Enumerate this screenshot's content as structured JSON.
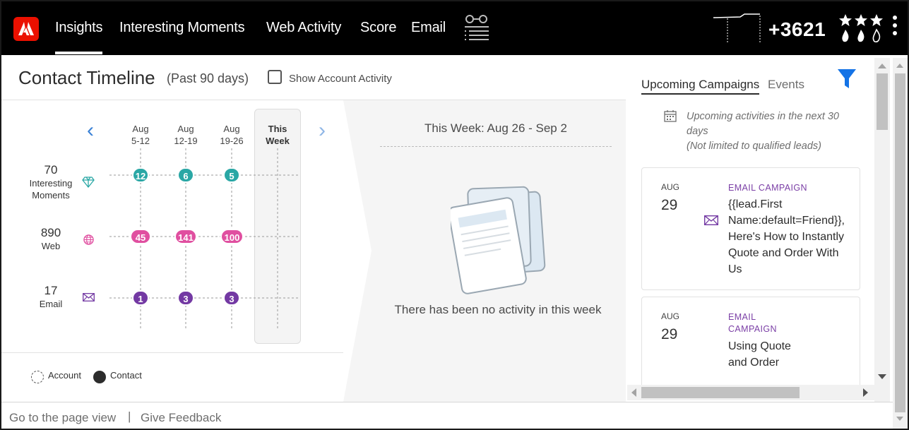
{
  "nav": {
    "tabs": [
      {
        "label": "Insights",
        "active": true
      },
      {
        "label": "Interesting Moments",
        "active": false
      },
      {
        "label": "Web Activity",
        "active": false
      },
      {
        "label": "Score",
        "active": false
      },
      {
        "label": "Email",
        "active": false
      }
    ],
    "score": "+3621",
    "icons": [
      "adobe-logo-icon",
      "glasses-list-icon",
      "score-sparkline-icon",
      "stars-flames-icon",
      "more-vertical-icon"
    ]
  },
  "timeline": {
    "title": "Contact Timeline",
    "range": "(Past 90 days)",
    "show_account_label": "Show Account Activity",
    "show_account_checked": false,
    "columns": [
      {
        "month": "Aug",
        "days": "5-12"
      },
      {
        "month": "Aug",
        "days": "12-19"
      },
      {
        "month": "Aug",
        "days": "19-26"
      },
      {
        "month": "This",
        "days": "Week"
      }
    ],
    "rows": [
      {
        "total": "70",
        "label": "Interesting Moments",
        "icon": "diamond-icon",
        "color": "#2aa7a5",
        "values": [
          "12",
          "6",
          "5"
        ]
      },
      {
        "total": "890",
        "label": "Web",
        "icon": "globe-icon",
        "color": "#e04fa0",
        "values": [
          "45",
          "141",
          "100"
        ]
      },
      {
        "total": "17",
        "label": "Email",
        "icon": "envelope-icon",
        "color": "#7339a3",
        "values": [
          "1",
          "3",
          "3"
        ]
      }
    ],
    "legend": {
      "account": "Account",
      "contact": "Contact"
    }
  },
  "week": {
    "title": "This Week: Aug 26 - Sep 2",
    "empty_text": "There has been no activity in this week"
  },
  "right_panel": {
    "tabs": [
      {
        "label": "Upcoming Campaigns",
        "active": true
      },
      {
        "label": "Events",
        "active": false
      }
    ],
    "note_line1": "Upcoming activities in the next 30 days",
    "note_line2": "(Not limited to qualified leads)",
    "cards": [
      {
        "month": "AUG",
        "day": "29",
        "type": "EMAIL CAMPAIGN",
        "title": "{{lead.First Name:default=Friend}}, Here's How to Instantly Quote and Order With Us"
      },
      {
        "month": "AUG",
        "day": "29",
        "type": "EMAIL CAMPAIGN",
        "title": "Using Quote and Order"
      }
    ]
  },
  "footer": {
    "page_view": "Go to the page view",
    "separator": "|",
    "feedback": "Give Feedback"
  }
}
